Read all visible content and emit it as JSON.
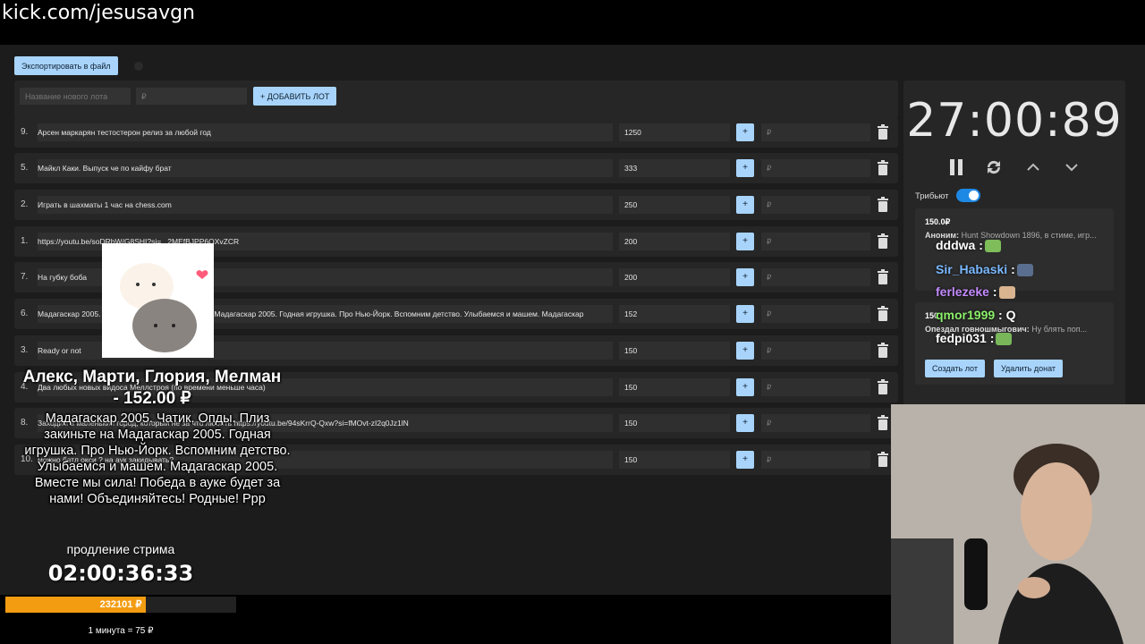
{
  "browser": {
    "url": "kick.com/jesusavgn"
  },
  "toolbar": {
    "export_label": "Экспортировать в файл"
  },
  "new_lot": {
    "name_placeholder": "Название нового лота",
    "amount_placeholder": "₽",
    "add_label": "+ ДОБАВИТЬ ЛОТ"
  },
  "lots": [
    {
      "num": "9.",
      "title": "Арсен маркарян тестостерон релиз за любой год",
      "amount": "1250",
      "plus": "+",
      "currency": "₽"
    },
    {
      "num": "5.",
      "title": "Майкл Каки. Выпуск че по кайфу брат",
      "amount": "333",
      "plus": "+",
      "currency": "₽"
    },
    {
      "num": "2.",
      "title": "Играть в шахматы 1 час на chess.com",
      "amount": "250",
      "plus": "+",
      "currency": "₽"
    },
    {
      "num": "1.",
      "title": "https://youtu.be/soDRbW/G8SHI?si=...2MEfBJPP6OXvZCR",
      "amount": "200",
      "plus": "+",
      "currency": "₽"
    },
    {
      "num": "7.",
      "title": "На губку боба",
      "amount": "200",
      "plus": "+",
      "currency": "₽"
    },
    {
      "num": "6.",
      "title": "Мадагаскар 2005. Чатик. Опды. Плиз закиньте на Мадагаскар 2005. Годная игрушка. Про Нью-Йорк. Вспомним детство. Улыбаемся и машем. Мадагаскар",
      "amount": "152",
      "plus": "+",
      "currency": "₽"
    },
    {
      "num": "3.",
      "title": "Ready or not",
      "amount": "150",
      "plus": "+",
      "currency": "₽"
    },
    {
      "num": "4.",
      "title": "Два любых новых видоса Меллстроя (по времени меньше часа)",
      "amount": "150",
      "plus": "+",
      "currency": "₽"
    },
    {
      "num": "8.",
      "title": "Заходим в маленький город, который не за что любить https://youtu.be/94sKrrQ-Qxw?si=fMOvt-zI2q0Jz1lN",
      "amount": "150",
      "plus": "+",
      "currency": "₽"
    },
    {
      "num": "10.",
      "title": "можно батл окси ? на аук закидывать?",
      "amount": "150",
      "plus": "+",
      "currency": "₽"
    }
  ],
  "timer": {
    "value": "27:00:89"
  },
  "tribute": {
    "label": "Трибьют",
    "enabled": true
  },
  "donations": [
    {
      "amount": "150.0₽",
      "author": "Аноним:",
      "text": "Hunt Showdown 1896, в стиме, игр..."
    },
    {
      "amount": "150",
      "author": "Опездал говношмыгович:",
      "text": "Ну блять поп..."
    }
  ],
  "donation_actions": {
    "create_lot": "Создать лот",
    "delete_donate": "Удалить донат"
  },
  "chat": [
    {
      "user": "dddwa",
      "msg": ":",
      "color": "#ffffff"
    },
    {
      "user": "Sir_Habaski",
      "msg": ":",
      "color": "#7ab8ff"
    },
    {
      "user": "ferlezeke",
      "msg": ":",
      "color": "#c38bff"
    },
    {
      "user": "qmor1999",
      "msg": ": Q",
      "color": "#8bef6a"
    },
    {
      "user": "fedpi031",
      "msg": ":",
      "color": "#ffffff"
    }
  ],
  "alert": {
    "title": "Алекс, Марти, Глория, Мелман - 152.00 ₽",
    "message": "Мадагаскар 2005. Чатик. Опды. Плиз закиньте на Мадагаскар 2005. Годная игрушка. Про Нью-Йорк. Вспомним детство. Улыбаемся и машем. Мадагаскар 2005. Вместе мы сила! Победа в ауке будет за нами! Объединяйтесь! Родные! Ррр"
  },
  "extension": {
    "label": "продление стрима",
    "timer": "02:00:36:33"
  },
  "progress": {
    "text": "232101 ₽",
    "fill_fraction": 0.61
  },
  "rate": {
    "text": "1 минута = 75 ₽"
  },
  "colors": {
    "accent": "#a8d4fb",
    "toggle": "#1e88e5",
    "progress": "#f39c12"
  }
}
